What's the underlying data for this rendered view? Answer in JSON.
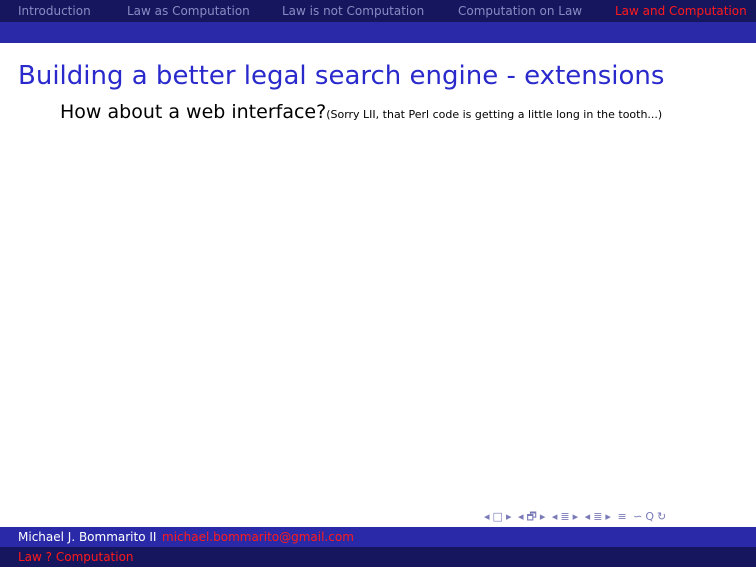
{
  "nav": {
    "sections": [
      "Introduction",
      "Law as Computation",
      "Law is not Computation",
      "Computation on Law",
      "Law and Computation"
    ],
    "active_index": 4
  },
  "frame": {
    "title": "Building a better legal search engine - extensions",
    "bullet_main": "How about a web interface?",
    "bullet_note": "(Sorry LII, that Perl code is getting a little long in the tooth...)"
  },
  "controls": {
    "prev_frame": "◂",
    "frame_icon": "□",
    "next_frame": "▸",
    "prev_subsection": "◂",
    "subsection_icon": "🗗",
    "next_subsection": "▸",
    "prev_section": "◂",
    "section_icon": "≣",
    "next_section": "▸",
    "prev_doc": "◂",
    "doc_icon": "≣",
    "next_doc": "▸",
    "toc_icon": "≡",
    "search_icon": "∽",
    "zoom_icon": "Q",
    "back_icon": "↻"
  },
  "footer": {
    "author": "Michael J. Bommarito II",
    "email": "michael.bommarito@gmail.com",
    "short_title": "Law ? Computation"
  },
  "colors": {
    "nav_bg": "#16165e",
    "strip_bg": "#2a2aa8",
    "title": "#2a2acc",
    "highlight": "#ff1a1a"
  }
}
